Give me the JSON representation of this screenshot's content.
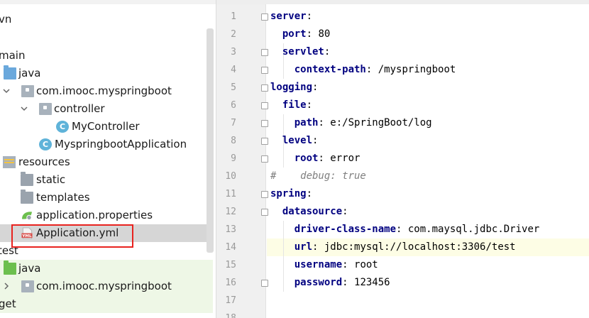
{
  "project_tree": {
    "rows": [
      {
        "text": "vn",
        "indent": 0,
        "icon": "none"
      },
      {
        "text": "main",
        "indent": 1,
        "icon": "none",
        "expanded": true
      },
      {
        "text": "java",
        "indent": 2,
        "icon": "folder-blue"
      },
      {
        "text": "com.imooc.myspringboot",
        "indent": 3,
        "icon": "package",
        "expanded": true
      },
      {
        "text": "controller",
        "indent": 4,
        "icon": "package",
        "expanded": true
      },
      {
        "text": "MyController",
        "indent": 5,
        "icon": "class-icon"
      },
      {
        "text": "MyspringbootApplication",
        "indent": 4,
        "icon": "spring-class-icon"
      },
      {
        "text": "resources",
        "indent": 1,
        "icon": "resources-folder"
      },
      {
        "text": "static",
        "indent": 2,
        "icon": "folder-gray"
      },
      {
        "text": "templates",
        "indent": 2,
        "icon": "folder-gray"
      },
      {
        "text": "application.properties",
        "indent": 2,
        "icon": "spring-properties-icon"
      },
      {
        "text": "Application.yml",
        "indent": 2,
        "icon": "yml-file-icon",
        "selected": true
      },
      {
        "text": "test",
        "indent": 0,
        "icon": "none"
      },
      {
        "text": "java",
        "indent": 1,
        "icon": "folder-green"
      },
      {
        "text": "com.imooc.myspringboot",
        "indent": 2,
        "icon": "package",
        "collapsed": true
      },
      {
        "text": "get",
        "indent": 0,
        "icon": "none"
      }
    ],
    "class_badge": "C",
    "yml_badge": "YML"
  },
  "editor": {
    "current_line": 14,
    "lines": [
      {
        "n": "1",
        "indent": "",
        "key": "server",
        "sep": ":",
        "value": ""
      },
      {
        "n": "2",
        "indent": "  ",
        "key": "port",
        "sep": ":",
        "value": " 80"
      },
      {
        "n": "3",
        "indent": "  ",
        "key": "servlet",
        "sep": ":",
        "value": ""
      },
      {
        "n": "4",
        "indent": "    ",
        "key": "context-path",
        "sep": ":",
        "value": " /myspringboot"
      },
      {
        "n": "5",
        "indent": "",
        "key": "logging",
        "sep": ":",
        "value": ""
      },
      {
        "n": "6",
        "indent": "  ",
        "key": "file",
        "sep": ":",
        "value": ""
      },
      {
        "n": "7",
        "indent": "    ",
        "key": "path",
        "sep": ":",
        "value": " e:/SpringBoot/log"
      },
      {
        "n": "8",
        "indent": "  ",
        "key": "level",
        "sep": ":",
        "value": ""
      },
      {
        "n": "9",
        "indent": "    ",
        "key": "root",
        "sep": ":",
        "value": " error"
      },
      {
        "n": "10",
        "indent": "",
        "key": "",
        "sep": "",
        "value": "",
        "comment": "#    debug: true"
      },
      {
        "n": "11",
        "indent": "",
        "key": "spring",
        "sep": ":",
        "value": ""
      },
      {
        "n": "12",
        "indent": "  ",
        "key": "datasource",
        "sep": ":",
        "value": ""
      },
      {
        "n": "13",
        "indent": "    ",
        "key": "driver-class-name",
        "sep": ":",
        "value": " com.maysql.jdbc.Driver"
      },
      {
        "n": "14",
        "indent": "    ",
        "key": "url",
        "sep": ":",
        "value": " jdbc:mysql://localhost:3306/test"
      },
      {
        "n": "15",
        "indent": "    ",
        "key": "username",
        "sep": ":",
        "value": " root"
      },
      {
        "n": "16",
        "indent": "    ",
        "key": "password",
        "sep": ":",
        "value": " 123456"
      },
      {
        "n": "17",
        "indent": "",
        "key": "",
        "sep": "",
        "value": ""
      },
      {
        "n": "18",
        "indent": "",
        "key": "",
        "sep": "",
        "value": ""
      }
    ]
  },
  "colors": {
    "yaml_key": "#000080",
    "highlight_box": "#e8231f",
    "current_line_bg": "#fdfde5",
    "selection_bg": "#d6d6d6"
  }
}
